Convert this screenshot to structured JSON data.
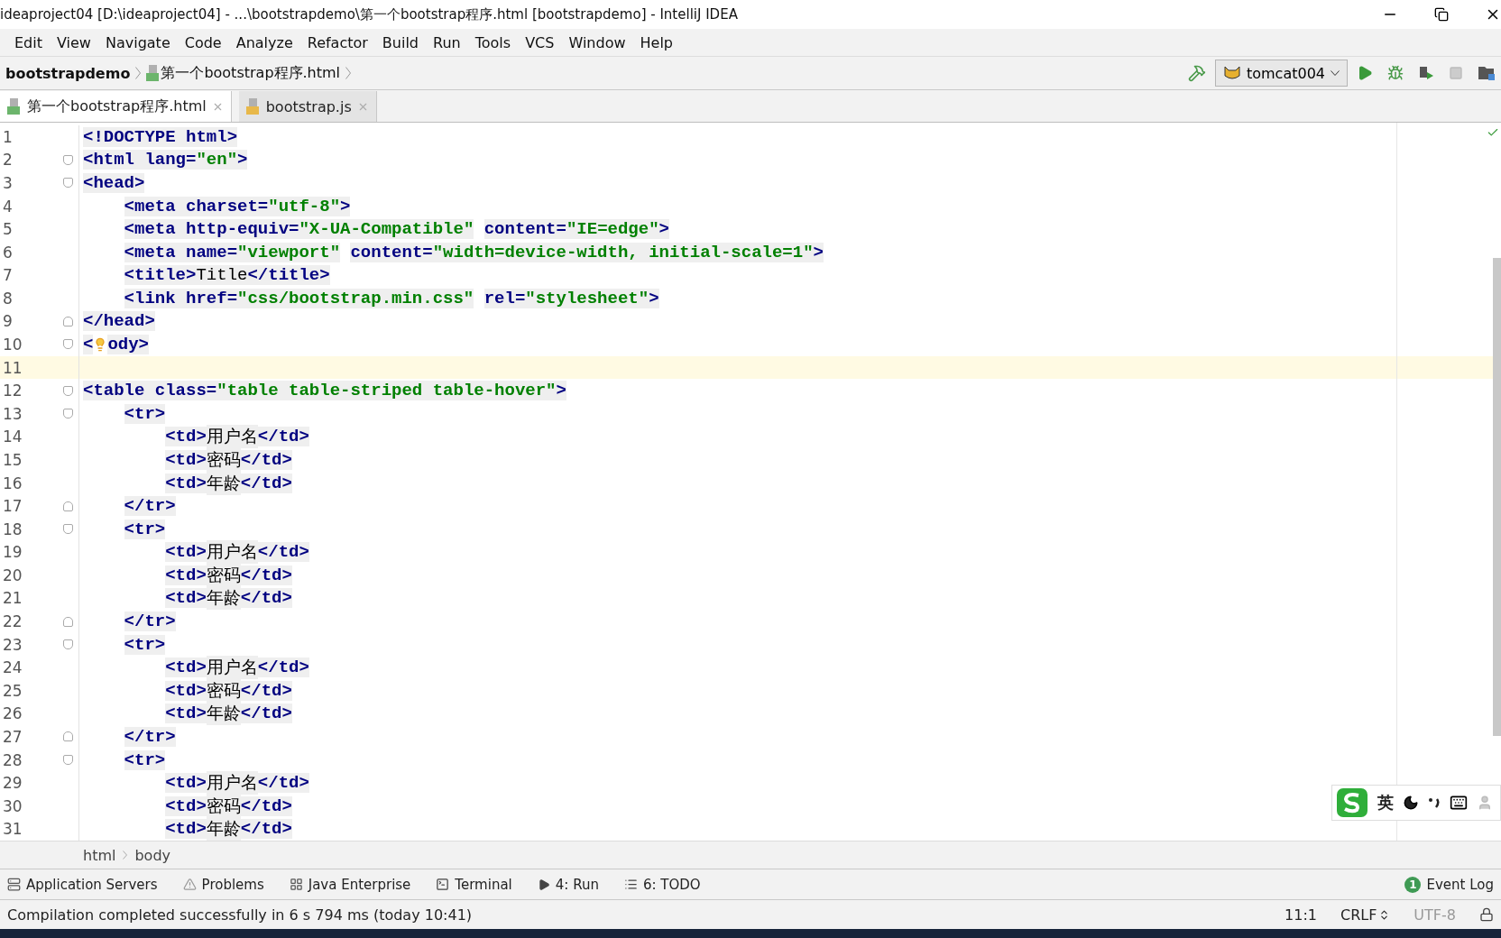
{
  "window": {
    "title": "ideaproject04 [D:\\ideaproject04] - ...\\bootstrapdemo\\第一个bootstrap程序.html [bootstrapdemo] - IntelliJ IDEA"
  },
  "menu": [
    "Edit",
    "View",
    "Navigate",
    "Code",
    "Analyze",
    "Refactor",
    "Build",
    "Run",
    "Tools",
    "VCS",
    "Window",
    "Help"
  ],
  "navigation_bar": [
    {
      "label": "bootstrapdemo",
      "kind": "project"
    },
    {
      "label": "第一个bootstrap程序.html",
      "kind": "file"
    }
  ],
  "run_configuration": "tomcat004",
  "tabs": [
    {
      "label": "第一个bootstrap程序.html",
      "kind": "html",
      "selected": true
    },
    {
      "label": "bootstrap.js",
      "kind": "js",
      "selected": false
    }
  ],
  "editor": {
    "lines": [
      {
        "number": "1",
        "current": false,
        "fold_start": false,
        "fold_end": false,
        "tokens": [
          {
            "kind": "markup",
            "text": "<!DOCTYPE html>"
          }
        ]
      },
      {
        "number": "2",
        "current": false,
        "fold_start": true,
        "fold_end": false,
        "tokens": [
          {
            "kind": "markup",
            "text": "<html lang="
          },
          {
            "kind": "value",
            "text": "\"en\""
          },
          {
            "kind": "markup",
            "text": ">"
          }
        ]
      },
      {
        "number": "3",
        "current": false,
        "fold_start": true,
        "fold_end": false,
        "tokens": [
          {
            "kind": "markup",
            "text": "<head>"
          }
        ]
      },
      {
        "number": "4",
        "current": false,
        "fold_start": false,
        "fold_end": false,
        "tokens": [
          {
            "kind": "markup",
            "text": "    <meta charset="
          },
          {
            "kind": "value",
            "text": "\"utf-8\""
          },
          {
            "kind": "markup",
            "text": ">"
          }
        ]
      },
      {
        "number": "5",
        "current": false,
        "fold_start": false,
        "fold_end": false,
        "tokens": [
          {
            "kind": "markup",
            "text": "    <meta http-equiv="
          },
          {
            "kind": "value",
            "text": "\"X-UA-Compatible\""
          },
          {
            "kind": "markup",
            "text": " content="
          },
          {
            "kind": "value",
            "text": "\"IE=edge\""
          },
          {
            "kind": "markup",
            "text": ">"
          }
        ]
      },
      {
        "number": "6",
        "current": false,
        "fold_start": false,
        "fold_end": false,
        "tokens": [
          {
            "kind": "markup",
            "text": "    <meta name="
          },
          {
            "kind": "value",
            "text": "\"viewport\""
          },
          {
            "kind": "markup",
            "text": " content="
          },
          {
            "kind": "value",
            "text": "\"width=device-width, initial-scale=1\""
          },
          {
            "kind": "markup",
            "text": ">"
          }
        ]
      },
      {
        "number": "7",
        "current": false,
        "fold_start": false,
        "fold_end": false,
        "tokens": [
          {
            "kind": "markup",
            "text": "    <title>"
          },
          {
            "kind": "text",
            "text": "Title"
          },
          {
            "kind": "markup",
            "text": "</title>"
          }
        ]
      },
      {
        "number": "8",
        "current": false,
        "fold_start": false,
        "fold_end": false,
        "tokens": [
          {
            "kind": "markup",
            "text": "    <link href="
          },
          {
            "kind": "value",
            "text": "\"css/bootstrap.min.css\""
          },
          {
            "kind": "markup",
            "text": " rel="
          },
          {
            "kind": "value",
            "text": "\"stylesheet\""
          },
          {
            "kind": "markup",
            "text": ">"
          }
        ]
      },
      {
        "number": "9",
        "current": false,
        "fold_start": false,
        "fold_end": true,
        "tokens": [
          {
            "kind": "markup",
            "text": "</head>"
          }
        ]
      },
      {
        "number": "10",
        "current": false,
        "fold_start": true,
        "fold_end": false,
        "tokens": [
          {
            "kind": "markup",
            "text": "<"
          },
          {
            "kind": "bulb"
          },
          {
            "kind": "markup",
            "text": "ody>"
          }
        ]
      },
      {
        "number": "11",
        "current": true,
        "fold_start": false,
        "fold_end": false
      },
      {
        "number": "12",
        "current": false,
        "fold_start": true,
        "fold_end": false,
        "tokens": [
          {
            "kind": "markup",
            "text": "<table class="
          },
          {
            "kind": "value",
            "text": "\"table table-striped table-hover\""
          },
          {
            "kind": "markup",
            "text": ">"
          }
        ]
      },
      {
        "number": "13",
        "current": false,
        "fold_start": true,
        "fold_end": false,
        "tokens": [
          {
            "kind": "markup",
            "text": "    <tr>"
          }
        ]
      },
      {
        "number": "14",
        "current": false,
        "fold_start": false,
        "fold_end": false,
        "tokens": [
          {
            "kind": "markup",
            "text": "        <td>"
          },
          {
            "kind": "text",
            "text": "用户名"
          },
          {
            "kind": "markup",
            "text": "</td>"
          }
        ]
      },
      {
        "number": "15",
        "current": false,
        "fold_start": false,
        "fold_end": false,
        "tokens": [
          {
            "kind": "markup",
            "text": "        <td>"
          },
          {
            "kind": "text",
            "text": "密码"
          },
          {
            "kind": "markup",
            "text": "</td>"
          }
        ]
      },
      {
        "number": "16",
        "current": false,
        "fold_start": false,
        "fold_end": false,
        "tokens": [
          {
            "kind": "markup",
            "text": "        <td>"
          },
          {
            "kind": "text",
            "text": "年龄"
          },
          {
            "kind": "markup",
            "text": "</td>"
          }
        ]
      },
      {
        "number": "17",
        "current": false,
        "fold_start": false,
        "fold_end": true,
        "tokens": [
          {
            "kind": "markup",
            "text": "    </tr>"
          }
        ]
      },
      {
        "number": "18",
        "current": false,
        "fold_start": true,
        "fold_end": false,
        "tokens": [
          {
            "kind": "markup",
            "text": "    <tr>"
          }
        ]
      },
      {
        "number": "19",
        "current": false,
        "fold_start": false,
        "fold_end": false,
        "tokens": [
          {
            "kind": "markup",
            "text": "        <td>"
          },
          {
            "kind": "text",
            "text": "用户名"
          },
          {
            "kind": "markup",
            "text": "</td>"
          }
        ]
      },
      {
        "number": "20",
        "current": false,
        "fold_start": false,
        "fold_end": false,
        "tokens": [
          {
            "kind": "markup",
            "text": "        <td>"
          },
          {
            "kind": "text",
            "text": "密码"
          },
          {
            "kind": "markup",
            "text": "</td>"
          }
        ]
      },
      {
        "number": "21",
        "current": false,
        "fold_start": false,
        "fold_end": false,
        "tokens": [
          {
            "kind": "markup",
            "text": "        <td>"
          },
          {
            "kind": "text",
            "text": "年龄"
          },
          {
            "kind": "markup",
            "text": "</td>"
          }
        ]
      },
      {
        "number": "22",
        "current": false,
        "fold_start": false,
        "fold_end": true,
        "tokens": [
          {
            "kind": "markup",
            "text": "    </tr>"
          }
        ]
      },
      {
        "number": "23",
        "current": false,
        "fold_start": true,
        "fold_end": false,
        "tokens": [
          {
            "kind": "markup",
            "text": "    <tr>"
          }
        ]
      },
      {
        "number": "24",
        "current": false,
        "fold_start": false,
        "fold_end": false,
        "tokens": [
          {
            "kind": "markup",
            "text": "        <td>"
          },
          {
            "kind": "text",
            "text": "用户名"
          },
          {
            "kind": "markup",
            "text": "</td>"
          }
        ]
      },
      {
        "number": "25",
        "current": false,
        "fold_start": false,
        "fold_end": false,
        "tokens": [
          {
            "kind": "markup",
            "text": "        <td>"
          },
          {
            "kind": "text",
            "text": "密码"
          },
          {
            "kind": "markup",
            "text": "</td>"
          }
        ]
      },
      {
        "number": "26",
        "current": false,
        "fold_start": false,
        "fold_end": false,
        "tokens": [
          {
            "kind": "markup",
            "text": "        <td>"
          },
          {
            "kind": "text",
            "text": "年龄"
          },
          {
            "kind": "markup",
            "text": "</td>"
          }
        ]
      },
      {
        "number": "27",
        "current": false,
        "fold_start": false,
        "fold_end": true,
        "tokens": [
          {
            "kind": "markup",
            "text": "    </tr>"
          }
        ]
      },
      {
        "number": "28",
        "current": false,
        "fold_start": true,
        "fold_end": false,
        "tokens": [
          {
            "kind": "markup",
            "text": "    <tr>"
          }
        ]
      },
      {
        "number": "29",
        "current": false,
        "fold_start": false,
        "fold_end": false,
        "tokens": [
          {
            "kind": "markup",
            "text": "        <td>"
          },
          {
            "kind": "text",
            "text": "用户名"
          },
          {
            "kind": "markup",
            "text": "</td>"
          }
        ]
      },
      {
        "number": "30",
        "current": false,
        "fold_start": false,
        "fold_end": false,
        "tokens": [
          {
            "kind": "markup",
            "text": "        <td>"
          },
          {
            "kind": "text",
            "text": "密码"
          },
          {
            "kind": "markup",
            "text": "</td>"
          }
        ]
      },
      {
        "number": "31",
        "current": false,
        "fold_start": false,
        "fold_end": false,
        "tokens": [
          {
            "kind": "markup",
            "text": "        <td>"
          },
          {
            "kind": "text",
            "text": "年龄"
          },
          {
            "kind": "markup",
            "text": "</td>"
          }
        ]
      }
    ]
  },
  "ime_bar": {
    "mode": "英"
  },
  "breadcrumbs": [
    "html",
    "body"
  ],
  "tool_windows": [
    {
      "label": "Application Servers",
      "kind": "servers"
    },
    {
      "label": "Problems",
      "kind": "problems"
    },
    {
      "label": "Java Enterprise",
      "kind": "enterprise"
    },
    {
      "label": "Terminal",
      "kind": "terminal"
    },
    {
      "label": "4: Run",
      "kind": "run"
    },
    {
      "label": "6: TODO",
      "kind": "todo"
    }
  ],
  "event_log": {
    "label": "Event Log",
    "badge": "1"
  },
  "status_bar": {
    "message": "Compilation completed successfully in 6 s 794 ms (today 10:41)",
    "position": "11:1",
    "line_separator": "CRLF",
    "encoding": "UTF-8"
  }
}
